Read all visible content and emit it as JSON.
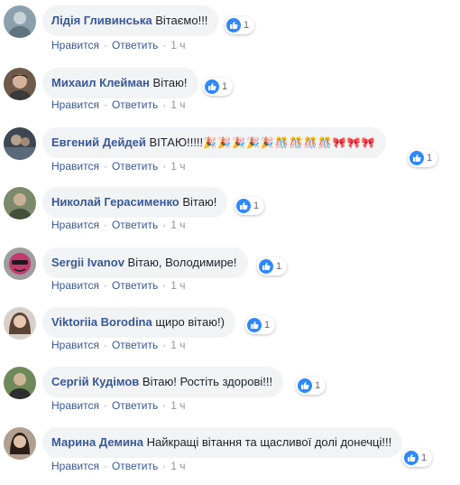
{
  "ui": {
    "like_label": "Нравится",
    "reply_label": "Ответить",
    "separator": "·"
  },
  "comments": [
    {
      "author": "Лідія Гливинська",
      "text": "Вітаємо!!!",
      "emoji": "",
      "likes": "1",
      "time": "1 ч"
    },
    {
      "author": "Михаил Клейман",
      "text": "Вітаю!",
      "emoji": "",
      "likes": "1",
      "time": "1 ч"
    },
    {
      "author": "Евгений Дейдей",
      "text": "ВІТАЮ!!!!!",
      "emoji": "🎉🎉🎉🎉🎉🎊🎊🎊🎊🎀🎀🎀",
      "likes": "1",
      "time": "1 ч"
    },
    {
      "author": "Николай Герасименко",
      "text": "Вітаю!",
      "emoji": "",
      "likes": "1",
      "time": "1 ч"
    },
    {
      "author": "Sergii Ivanov",
      "text": "Вітаю, Володимире!",
      "emoji": "",
      "likes": "1",
      "time": "1 ч"
    },
    {
      "author": "Viktoriia Borodina",
      "text": "щиро вітаю!)",
      "emoji": "",
      "likes": "1",
      "time": "1 ч"
    },
    {
      "author": "Сергій Кудімов",
      "text": "Вітаю! Ростіть здорові!!!",
      "emoji": "",
      "likes": "1",
      "time": "1 ч"
    },
    {
      "author": "Марина Демина",
      "text": "Найкращі вітання та щасливої долі донечці!!!",
      "emoji": "",
      "likes": "1",
      "time": "1 ч"
    }
  ],
  "colors": {
    "author": "#385898",
    "bubble_bg": "#f2f3f5",
    "meta_text": "#90949c",
    "like_badge": "#2e89ff"
  },
  "icons": {
    "like": "thumbs-up-icon",
    "avatar": "avatar-photo"
  }
}
